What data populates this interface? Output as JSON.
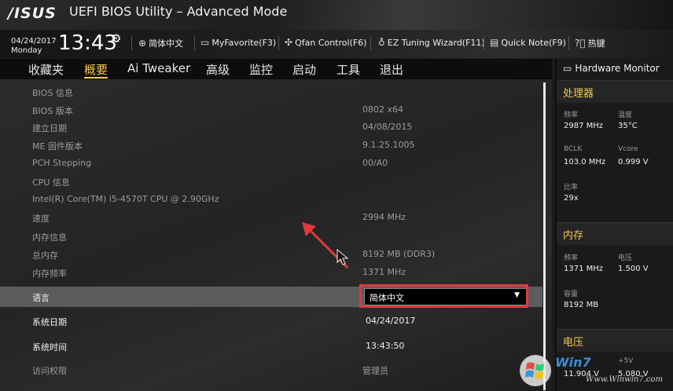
{
  "window": {
    "logo": "/ISUS",
    "title": "UEFI BIOS Utility – Advanced Mode"
  },
  "toolbar": {
    "date": "04/24/2017",
    "weekday": "Monday",
    "time": "13:43",
    "items": [
      {
        "label": "简体中文",
        "icon": "globe-icon"
      },
      {
        "label": "MyFavorite(F3)",
        "icon": "favorite-icon"
      },
      {
        "label": "Qfan Control(F6)",
        "icon": "fan-icon"
      },
      {
        "label": "EZ Tuning Wizard(F11)",
        "icon": "bulb-icon"
      },
      {
        "label": "Quick Note(F9)",
        "icon": "note-icon"
      },
      {
        "label": "热键",
        "icon": "help-icon"
      }
    ]
  },
  "menu": {
    "tabs": [
      "收藏夹",
      "概要",
      "Ai Tweaker",
      "高级",
      "监控",
      "启动",
      "工具",
      "退出"
    ],
    "active": "概要"
  },
  "main": {
    "rows": [
      {
        "key": "BIOS 信息",
        "value": ""
      },
      {
        "key": "BIOS 版本",
        "value": "0802 x64"
      },
      {
        "key": "建立日期",
        "value": "04/08/2015"
      },
      {
        "key": "ME 固件版本",
        "value": "9.1.25.1005"
      },
      {
        "key": "PCH Stepping",
        "value": "00/A0"
      },
      {
        "key": "CPU 信息",
        "value": ""
      },
      {
        "key": "Intel(R) Core(TM) i5-4570T CPU @ 2.90GHz",
        "value": ""
      },
      {
        "key": "速度",
        "value": "2994 MHz"
      },
      {
        "key": "内存信息",
        "value": ""
      },
      {
        "key": "总内存",
        "value": "8192 MB (DDR3)"
      },
      {
        "key": "内存频率",
        "value": "1371 MHz"
      }
    ],
    "language": {
      "label": "语言",
      "value": "简体中文"
    },
    "system_date": {
      "label": "系统日期",
      "value": "04/24/2017"
    },
    "system_time": {
      "label": "系统时间",
      "value": "13:43:50"
    },
    "access": {
      "label": "访问权限",
      "value": "管理员"
    }
  },
  "hardware_monitor": {
    "title": "Hardware Monitor",
    "cpu": {
      "title": "处理器",
      "freq_label": "频率",
      "freq": "2987 MHz",
      "temp_label": "温度",
      "temp": "35°C",
      "bclk_label": "BCLK",
      "bclk": "103.0 MHz",
      "vcore_label": "Vcore",
      "vcore": "0.999 V",
      "ratio_label": "比率",
      "ratio": "29x"
    },
    "memory": {
      "title": "内存",
      "freq_label": "频率",
      "freq": "1371 MHz",
      "volt_label": "电压",
      "volt": "1.500 V",
      "cap_label": "容量",
      "cap": "8192 MB"
    },
    "voltage": {
      "title": "电压",
      "v12": "11.904 V",
      "v5_label": "+5V",
      "v5": "5.080 V"
    }
  },
  "watermark": {
    "brand": "Win7",
    "url": "Www.Winwin7.com"
  },
  "colors": {
    "accent": "#f2c94c",
    "annotation": "#e03a3a"
  }
}
